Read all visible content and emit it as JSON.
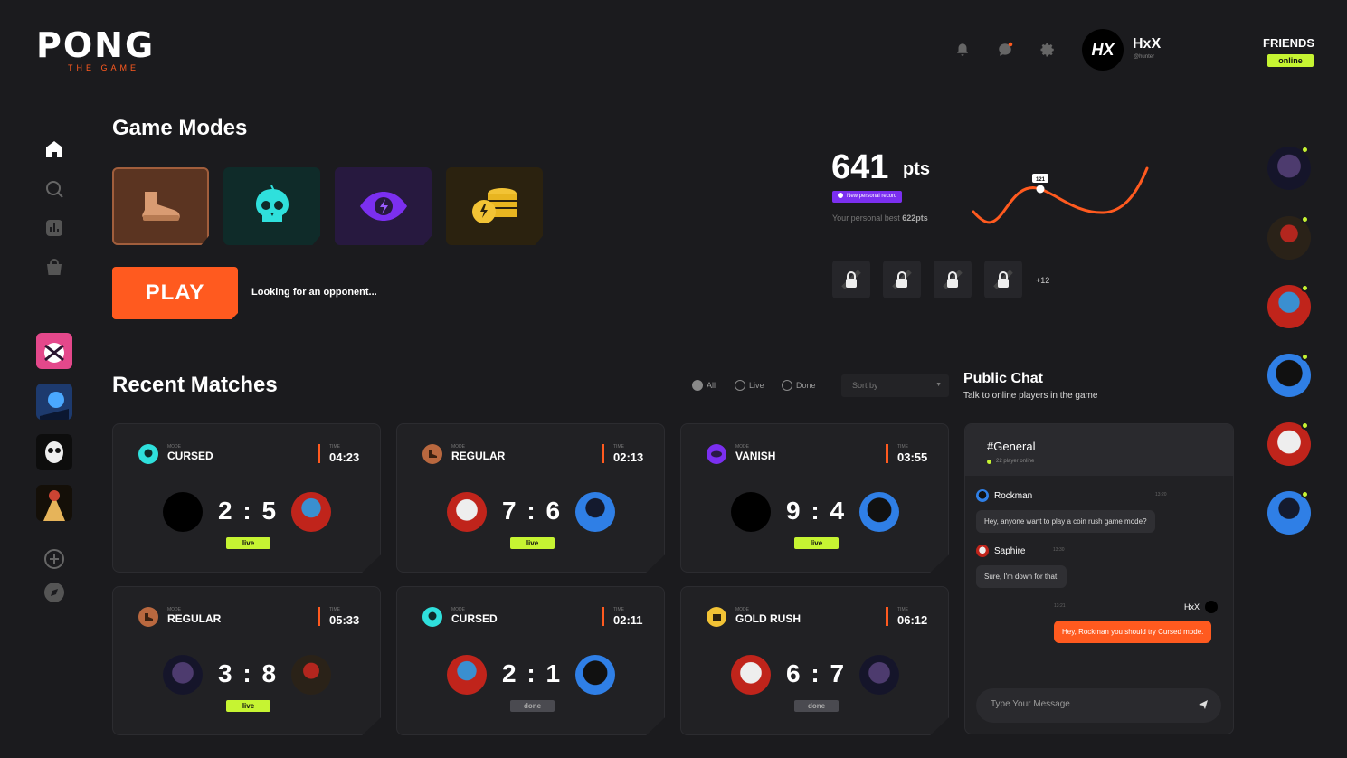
{
  "logo": {
    "title": "PONG",
    "subtitle": "THE GAME"
  },
  "topbar": {
    "icons": [
      "bell-icon",
      "chat-icon",
      "gear-icon"
    ],
    "user": {
      "avatar_text": "HX",
      "name": "HxX",
      "handle": "@hunter"
    }
  },
  "friends": {
    "title": "FRIENDS",
    "status": "online"
  },
  "game_modes": {
    "heading": "Game Modes",
    "modes": [
      {
        "name": "regular",
        "icon": "boot-icon",
        "color": "#5b3421"
      },
      {
        "name": "cursed",
        "icon": "skull-icon",
        "color": "#0f2b29"
      },
      {
        "name": "vanish",
        "icon": "eye-icon",
        "color": "#27193f"
      },
      {
        "name": "gold rush",
        "icon": "coins-icon",
        "color": "#2b220f"
      }
    ],
    "play_label": "PLAY",
    "looking_text": "Looking for an opponent..."
  },
  "stats": {
    "points": "641",
    "points_unit": "pts",
    "record_badge": "New personal record",
    "best_prefix": "Your personal best",
    "best_value": "622pts",
    "chart_marker": "121",
    "more_achievements": "+12"
  },
  "recent": {
    "heading": "Recent Matches",
    "filters": [
      "All",
      "Live",
      "Done"
    ],
    "sort_label": "Sort by",
    "mode_label": "MODE",
    "time_label": "TIME",
    "matches": [
      {
        "mode": "CURSED",
        "time": "04:23",
        "score": "2 : 5",
        "status": "live"
      },
      {
        "mode": "REGULAR",
        "time": "02:13",
        "score": "7 : 6",
        "status": "live"
      },
      {
        "mode": "VANISH",
        "time": "03:55",
        "score": "9 : 4",
        "status": "live"
      },
      {
        "mode": "REGULAR",
        "time": "05:33",
        "score": "3 : 8",
        "status": "live"
      },
      {
        "mode": "CURSED",
        "time": "02:11",
        "score": "2 : 1",
        "status": "done"
      },
      {
        "mode": "GOLD RUSH",
        "time": "06:12",
        "score": "6 : 7",
        "status": "done"
      }
    ]
  },
  "chat": {
    "title": "Public Chat",
    "subtitle": "Talk to online players in the game",
    "channel": "#General",
    "online_count": "22 player online",
    "messages": [
      {
        "author": "Rockman",
        "time": "13:20",
        "text": "Hey, anyone want to play a coin rush game mode?"
      },
      {
        "author": "Saphire",
        "time": "13:30",
        "text": "Sure, I'm down for that."
      },
      {
        "author": "HxX",
        "time": "13:21",
        "text": "Hey, Rockman you should try Cursed mode."
      }
    ],
    "input_placeholder": "Type Your Message"
  },
  "colors": {
    "accent": "#ff5a1f",
    "live": "#c6f432",
    "purple": "#7b2ff0",
    "bg": "#1b1b1e",
    "card": "#212124"
  }
}
